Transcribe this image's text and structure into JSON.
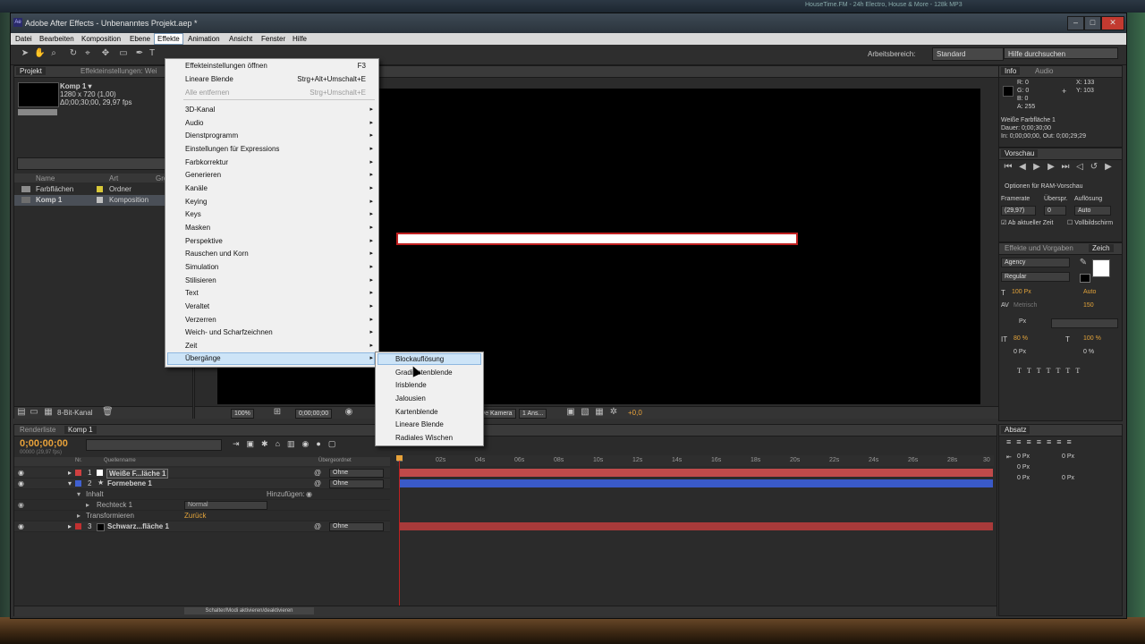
{
  "window": {
    "title": "Adobe After Effects - Unbenanntes Projekt.aep *",
    "logo_text": "Ae",
    "controls": [
      "–",
      "□",
      "✕"
    ]
  },
  "desktop": {
    "top_right_text": "HouseTime.FM - 24h Electro, House & More - 128k MP3"
  },
  "menubar": [
    "Datei",
    "Bearbeiten",
    "Komposition",
    "Ebene",
    "Effekte",
    "Animation",
    "Ansicht",
    "Fenster",
    "Hilfe"
  ],
  "toolbar": {
    "workspace_label": "Arbeitsbereich:",
    "workspace_value": "Standard",
    "search_placeholder": "Hilfe durchsuchen"
  },
  "project": {
    "tabs": [
      "Projekt",
      "Effekteinstellungen: Wei"
    ],
    "comp_name": "Komp 1 ▾",
    "comp_size": "1280 x 720 (1,00)",
    "comp_duration": "Δ0;00;30;00, 29,97 fps",
    "columns": [
      "Name",
      "Art",
      "Grö"
    ],
    "items": [
      {
        "name": "Farbflächen",
        "type": "Ordner",
        "color": "#d8c838"
      },
      {
        "name": "Komp 1",
        "type": "Komposition",
        "color": "#c0c0c0"
      }
    ],
    "footer_bit": "8-Bit-Kanal"
  },
  "viewer": {
    "zoom": "100%",
    "timecode": "0;00;00;00",
    "camera": "Aktive Kamera",
    "views": "1 Ans...",
    "offset": "+0,0"
  },
  "fx_menu": {
    "items": [
      {
        "label": "Effekteinstellungen öffnen",
        "shortcut": "F3"
      },
      {
        "label": "Lineare Blende",
        "shortcut": "Strg+Alt+Umschalt+E"
      },
      {
        "label": "Alle entfernen",
        "shortcut": "Strg+Umschalt+E",
        "disabled": true
      },
      {
        "label": "3D-Kanal",
        "submenu": true
      },
      {
        "label": "Audio",
        "submenu": true
      },
      {
        "label": "Dienstprogramm",
        "submenu": true
      },
      {
        "label": "Einstellungen für Expressions",
        "submenu": true
      },
      {
        "label": "Farbkorrektur",
        "submenu": true
      },
      {
        "label": "Generieren",
        "submenu": true
      },
      {
        "label": "Kanäle",
        "submenu": true
      },
      {
        "label": "Keying",
        "submenu": true
      },
      {
        "label": "Keys",
        "submenu": true
      },
      {
        "label": "Masken",
        "submenu": true
      },
      {
        "label": "Perspektive",
        "submenu": true
      },
      {
        "label": "Rauschen und Korn",
        "submenu": true
      },
      {
        "label": "Simulation",
        "submenu": true
      },
      {
        "label": "Stilisieren",
        "submenu": true
      },
      {
        "label": "Text",
        "submenu": true
      },
      {
        "label": "Veraltet",
        "submenu": true
      },
      {
        "label": "Verzerren",
        "submenu": true
      },
      {
        "label": "Weich- und Scharfzeichnen",
        "submenu": true
      },
      {
        "label": "Zeit",
        "submenu": true
      },
      {
        "label": "Übergänge",
        "submenu": true,
        "highlighted": true
      }
    ]
  },
  "submenu": [
    "Blockauflösung",
    "Gradientenblende",
    "Irisblende",
    "Jalousien",
    "Kartenblende",
    "Lineare Blende",
    "Radiales Wischen"
  ],
  "info": {
    "tabs": [
      "Info",
      "Audio"
    ],
    "r": "R: 0",
    "g": "G: 0",
    "b": "B: 0",
    "a": "A: 255",
    "x": "X: 133",
    "y": "Y: 103",
    "layer": "Weiße Farbfläche 1",
    "duration": "Dauer: 0;00;30;00",
    "inout": "In: 0;00;00;00, Out: 0;00;29;29"
  },
  "preview": {
    "tab": "Vorschau",
    "ram_options": "Optionen für RAM-Vorschau",
    "framerate_label": "Framerate",
    "skip_label": "Überspr.",
    "resolution_label": "Auflösung",
    "framerate": "(29,97)",
    "skip": "0",
    "resolution": "Auto",
    "from_current": "Ab aktueller Zeit",
    "fullscreen": "Vollbildschirm"
  },
  "character": {
    "tabs": [
      "Effekte und Vorgaben",
      "Zeich"
    ],
    "font": "Agency",
    "style": "Regular",
    "size": "100 Px",
    "leading": "Auto",
    "kerning": "Metrisch",
    "tracking": "150",
    "stroke_unit": "Px",
    "vscale": "80 %",
    "hscale": "100 %",
    "baseline": "0 Px",
    "tsume": "0 %"
  },
  "absatz": {
    "tab": "Absatz",
    "indent_vals": [
      "0 Px",
      "0 Px",
      "0 Px",
      "0 Px",
      "0 Px"
    ]
  },
  "timeline": {
    "tabs": [
      "Renderliste",
      "Komp 1"
    ],
    "time": "0;00;00;00",
    "time_sub": "00000 (29,97 fps)",
    "col_nr": "Nr.",
    "col_source": "Quellenname",
    "col_parent": "Übergeordnet",
    "ruler": [
      "0s",
      "02s",
      "04s",
      "06s",
      "08s",
      "10s",
      "12s",
      "14s",
      "16s",
      "18s",
      "20s",
      "22s",
      "24s",
      "26s",
      "28s",
      "30"
    ],
    "layers": [
      {
        "nr": "1",
        "name": "Weiße F...läche 1",
        "parent": "Ohne",
        "color": "#d04040",
        "bar": "#c04a4a"
      },
      {
        "nr": "2",
        "name": "Formebene 1",
        "parent": "Ohne",
        "color": "#4060d0",
        "bar": "#3a5ac8"
      },
      {
        "nr": "3",
        "name": "Schwarz...fläche 1",
        "parent": "Ohne",
        "color": "#c03030",
        "bar": "#a83a3a"
      }
    ],
    "content_label": "Inhalt",
    "add_label": "Hinzufügen:",
    "rect_label": "Rechteck 1",
    "rect_mode": "Normal",
    "transform_label": "Transformieren",
    "transform_reset": "Zurück",
    "footer": "Schalter/Modi aktivieren/deaktivieren"
  },
  "colors": {
    "accent_orange": "#e8a23a",
    "menu_highlight": "#cde4f7",
    "selection_red": "#c02020"
  }
}
